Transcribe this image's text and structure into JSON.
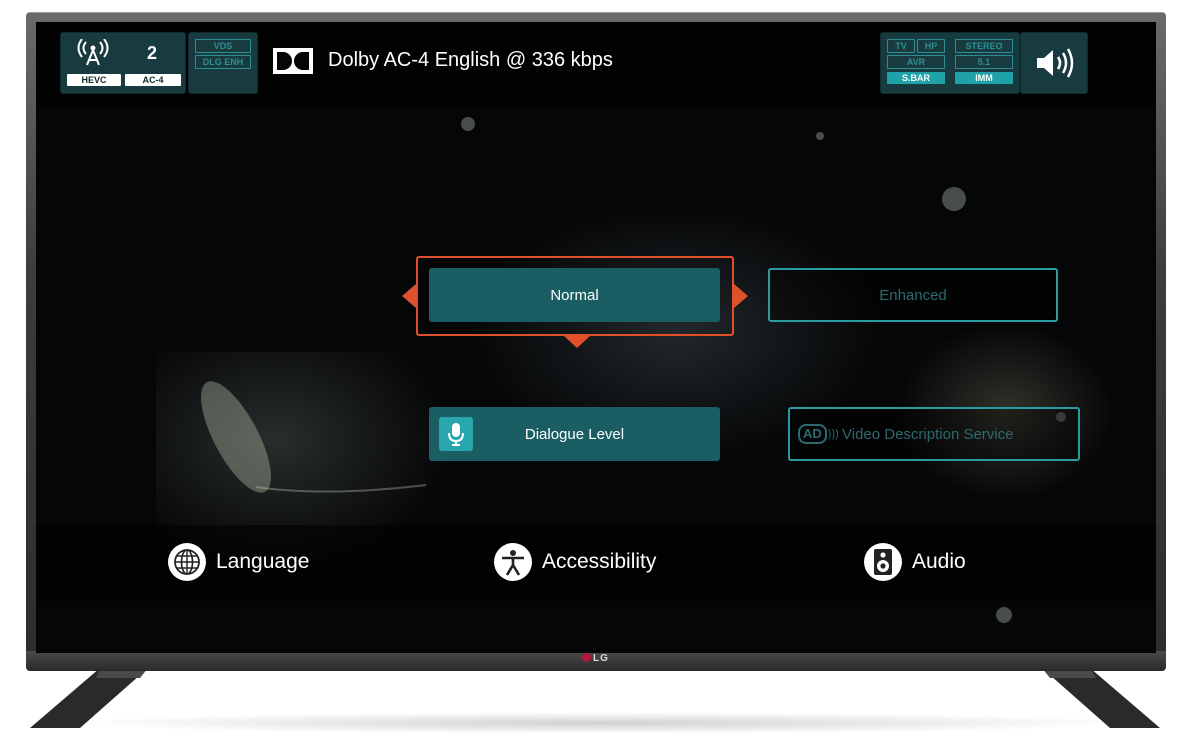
{
  "status": {
    "channel_number": "2",
    "video_codec": "HEVC",
    "audio_codec": "AC-4",
    "features": [
      "VDS",
      "DLG ENH"
    ],
    "outputs": [
      "TV",
      "HP",
      "AVR",
      "S.BAR"
    ],
    "active_output": "S.BAR",
    "modes": [
      "STEREO",
      "5.1",
      "IMM"
    ],
    "active_mode": "IMM"
  },
  "audio_stream": {
    "title": "Dolby AC-4 English @ 336 kbps"
  },
  "options": {
    "normal_label": "Normal",
    "enhanced_label": "Enhanced",
    "dialogue_level_label": "Dialogue Level",
    "video_description_label": "Video Description Service",
    "ad_badge": "AD"
  },
  "nav": {
    "language_label": "Language",
    "accessibility_label": "Accessibility",
    "audio_label": "Audio"
  },
  "brand": {
    "logo_text": "LG"
  },
  "colors": {
    "accent_teal": "#1a5e64",
    "highlight_orange": "#e0502b",
    "tile_teal": "#2aa6ad"
  },
  "icons": {
    "broadcast": "antenna-icon",
    "dolby": "dolby-logo",
    "speaker": "speaker-icon",
    "microphone": "microphone-icon",
    "language": "globe-icon",
    "accessibility": "person-icon",
    "audio": "speaker-box-icon"
  }
}
